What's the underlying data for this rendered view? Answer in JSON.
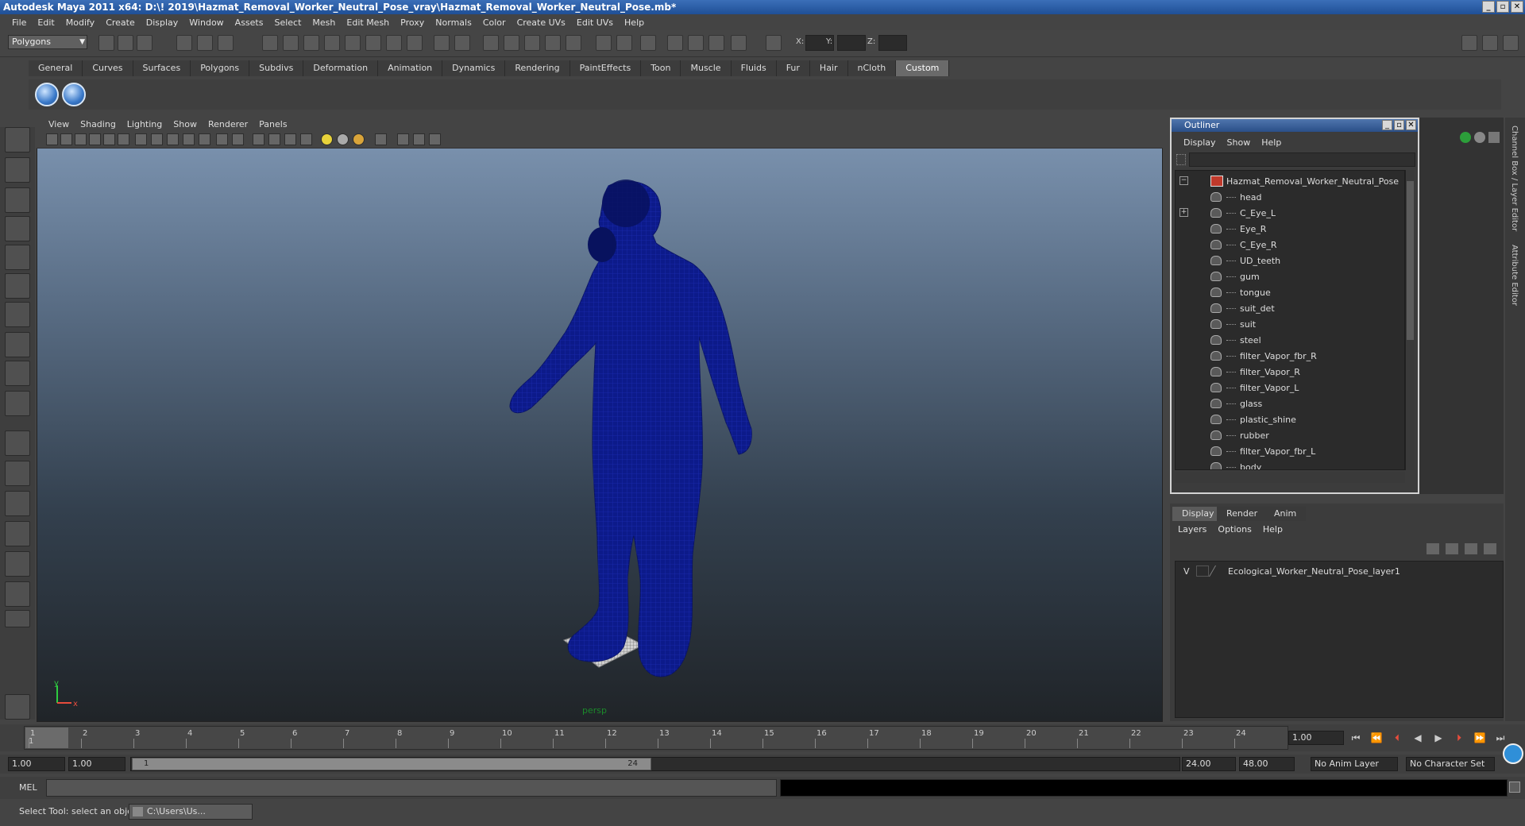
{
  "window": {
    "title": "Autodesk Maya 2011 x64: D:\\! 2019\\Hazmat_Removal_Worker_Neutral_Pose_vray\\Hazmat_Removal_Worker_Neutral_Pose.mb*"
  },
  "menubar": [
    "File",
    "Edit",
    "Modify",
    "Create",
    "Display",
    "Window",
    "Assets",
    "Select",
    "Mesh",
    "Edit Mesh",
    "Proxy",
    "Normals",
    "Color",
    "Create UVs",
    "Edit UVs",
    "Help"
  ],
  "statusline": {
    "mode": "Polygons",
    "x_label": "X:",
    "y_label": "Y:",
    "z_label": "Z:"
  },
  "shelf_tabs": [
    "General",
    "Curves",
    "Surfaces",
    "Polygons",
    "Subdivs",
    "Deformation",
    "Animation",
    "Dynamics",
    "Rendering",
    "PaintEffects",
    "Toon",
    "Muscle",
    "Fluids",
    "Fur",
    "Hair",
    "nCloth",
    "Custom"
  ],
  "viewport": {
    "menu": [
      "View",
      "Shading",
      "Lighting",
      "Show",
      "Renderer",
      "Panels"
    ],
    "camera": "persp",
    "axis_y": "y",
    "axis_x": "x",
    "wireframe_color": "#0c1a8a"
  },
  "outliner": {
    "title": "Outliner",
    "menu": [
      "Display",
      "Show",
      "Help"
    ],
    "root": "Hazmat_Removal_Worker_Neutral_Pose",
    "items": [
      "head",
      "C_Eye_L",
      "Eye_R",
      "C_Eye_R",
      "UD_teeth",
      "gum",
      "tongue",
      "suit_det",
      "suit",
      "steel",
      "filter_Vapor_fbr_R",
      "filter_Vapor_R",
      "filter_Vapor_L",
      "glass",
      "plastic_shine",
      "rubber",
      "filter_Vapor_fbr_L",
      "body"
    ]
  },
  "layer_editor": {
    "tabs": [
      "Display",
      "Render",
      "Anim"
    ],
    "menu": [
      "Layers",
      "Options",
      "Help"
    ],
    "layer_visibility": "V",
    "layer_name": "Ecological_Worker_Neutral_Pose_layer1"
  },
  "side_tabs": [
    "Channel Box / Layer Editor",
    "Attribute Editor"
  ],
  "timeline": {
    "ticks": [
      "1",
      "2",
      "3",
      "4",
      "5",
      "6",
      "7",
      "8",
      "9",
      "10",
      "11",
      "12",
      "13",
      "14",
      "15",
      "16",
      "17",
      "18",
      "19",
      "20",
      "21",
      "22",
      "23",
      "24"
    ],
    "current_frame_marker": "1",
    "current_frame": "1.00"
  },
  "range": {
    "start": "1.00",
    "playback_start": "1.00",
    "slider_start": "1",
    "slider_end": "24",
    "playback_end": "24.00",
    "end": "48.00",
    "anim_layer": "No Anim Layer",
    "character_set": "No Character Set"
  },
  "cmdline": {
    "label": "MEL"
  },
  "helpline": {
    "text": "Select Tool: select an object",
    "task": "C:\\Users\\Us..."
  }
}
